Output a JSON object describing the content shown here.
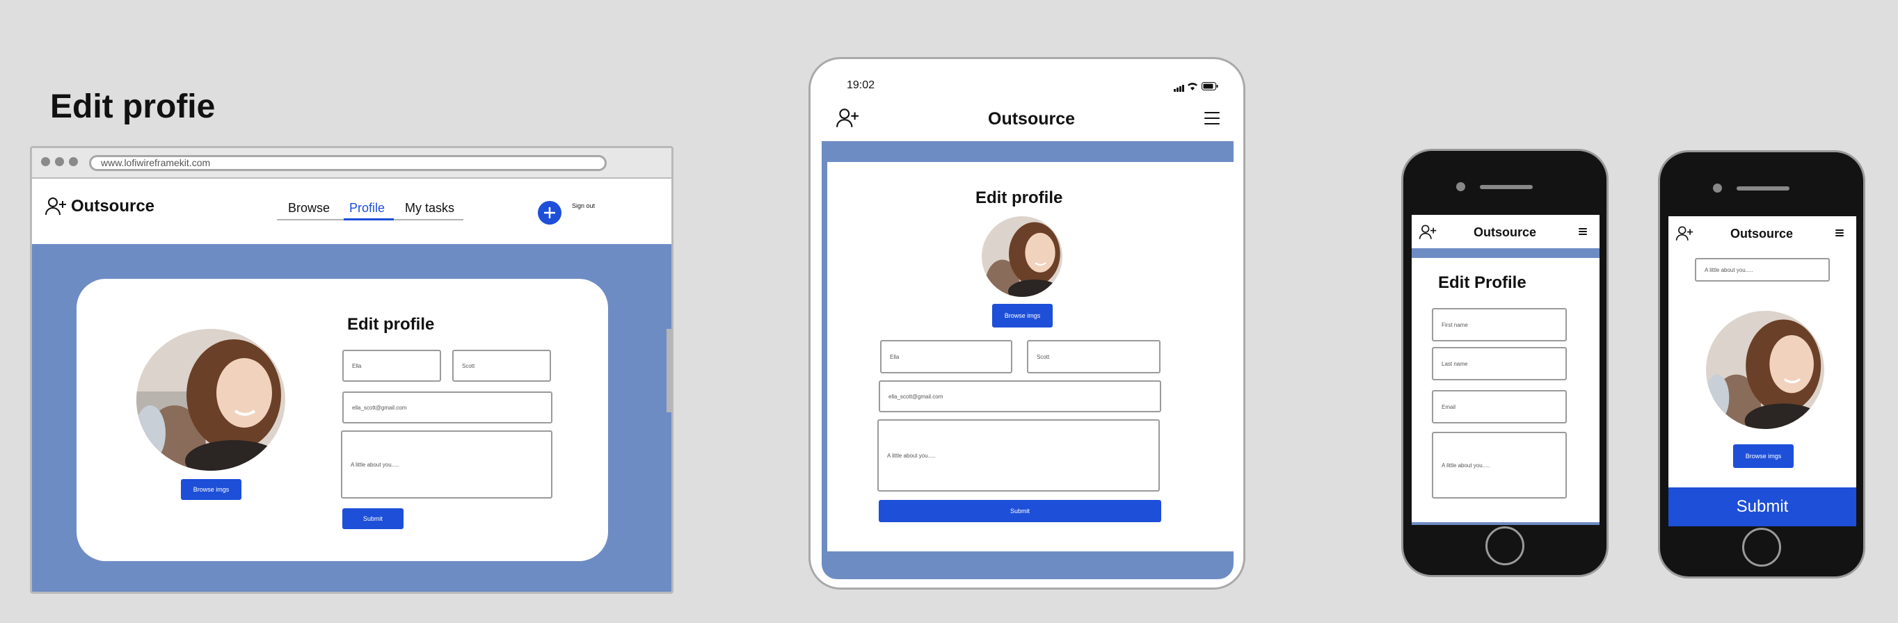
{
  "page_title": "Edit profie",
  "desktop": {
    "url": "www.lofiwireframekit.com",
    "logo": "Outsource",
    "nav": [
      "Browse",
      "Profile",
      "My tasks"
    ],
    "active_nav": "Profile",
    "sign_out": "Sign out",
    "form_title": "Edit profile",
    "first_name": "Ella",
    "last_name": "Scott",
    "email": "ella_scott@gmail.com",
    "bio": "A little about you.....",
    "browse_button": "Browse imgs",
    "submit_button": "Submit"
  },
  "tablet": {
    "time": "19:02",
    "logo": "Outsource",
    "form_title": "Edit profile",
    "browse_button": "Browse imgs",
    "first_name": "Ella",
    "last_name": "Scott",
    "email": "ella_scott@gmail.com",
    "bio": "A little about you.....",
    "submit_button": "Submit"
  },
  "phone1": {
    "logo": "Outsource",
    "form_title": "Edit Profile",
    "first_name_placeholder": "First name",
    "last_name_placeholder": "Last name",
    "email_placeholder": "Email",
    "bio_placeholder": "A little about you....."
  },
  "phone2": {
    "logo": "Outsource",
    "bio": "A little about you.....",
    "browse_button": "Browse imgs",
    "submit_button": "Submit"
  },
  "colors": {
    "accent": "#1d4fd8",
    "hero_blue": "#6e8cc4",
    "background": "#dedede"
  },
  "icons": [
    "add-user-icon",
    "plus-icon",
    "hamburger-menu-icon",
    "signal-icon",
    "wifi-icon",
    "battery-icon"
  ]
}
